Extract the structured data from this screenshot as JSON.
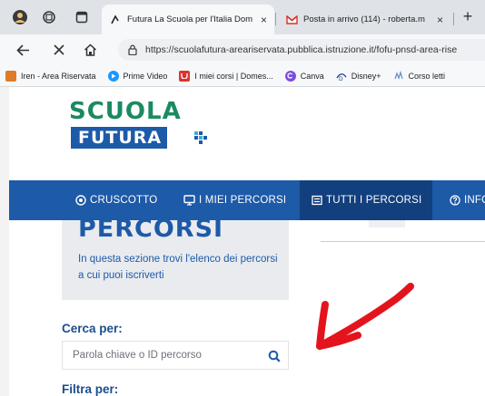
{
  "browser": {
    "tabs": [
      {
        "title": "Futura La Scuola per l'Italia Dom",
        "active": true,
        "close": "×"
      },
      {
        "title": "Posta in arrivo (114) - roberta.m",
        "active": false,
        "close": "×"
      }
    ],
    "new_tab": "+",
    "url": "https://scuolafutura-areariservata.pubblica.istruzione.it/fofu-pnsd-area-rise",
    "bookmarks": [
      {
        "label": "Iren - Area Riservata",
        "icon": "iren-icon",
        "color": "#e07b2a"
      },
      {
        "label": "Prime Video",
        "icon": "prime-video-icon",
        "color": "#1a98ff"
      },
      {
        "label": "I miei corsi | Domes...",
        "icon": "udemy-icon",
        "color": "#e0322c"
      },
      {
        "label": "Canva",
        "icon": "canva-icon",
        "color": "#7b4ee0"
      },
      {
        "label": "Disney+",
        "icon": "disney-icon",
        "color": "#1b3d8f"
      },
      {
        "label": "Corso letti",
        "icon": "bookmark-icon",
        "color": "#6a8fd0"
      }
    ]
  },
  "logo": {
    "line1": "SCUOLA",
    "line2": "FUTURA"
  },
  "nav": {
    "items": [
      {
        "label": "CRUSCOTTO",
        "icon": "dashboard-icon"
      },
      {
        "label": "I MIEI PERCORSI",
        "icon": "monitor-icon"
      },
      {
        "label": "TUTTI I PERCORSI",
        "icon": "list-icon",
        "active": true
      },
      {
        "label": "INFO",
        "icon": "help-icon"
      }
    ]
  },
  "section": {
    "heading": "PERCORSI",
    "description": "In questa sezione trovi l'elenco dei percorsi a cui puoi iscriverti"
  },
  "search": {
    "label": "Cerca per:",
    "placeholder": "Parola chiave o ID percorso"
  },
  "filter": {
    "label": "Filtra per:"
  },
  "colors": {
    "brand_blue": "#1d5aa8",
    "brand_green": "#1b8a60",
    "nav_active": "#123f7e",
    "annotation_red": "#e4141c"
  }
}
